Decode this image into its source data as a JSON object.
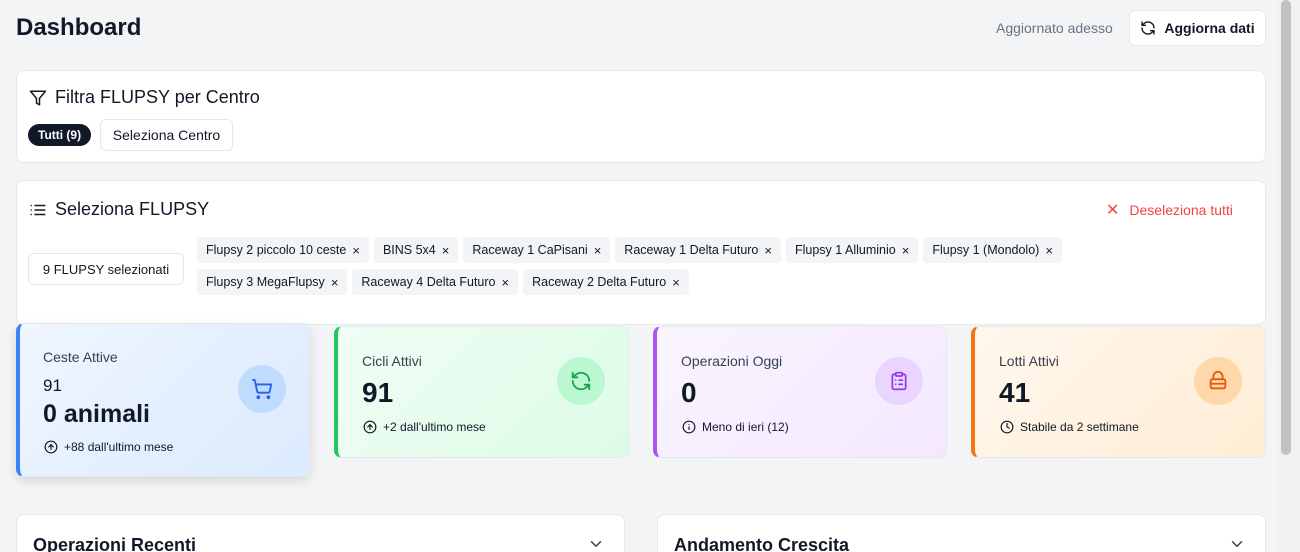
{
  "header": {
    "title": "Dashboard",
    "updated_text": "Aggiornato adesso",
    "refresh_label": "Aggiorna dati"
  },
  "center_filter": {
    "title": "Filtra FLUPSY per Centro",
    "all_label": "Tutti (9)",
    "select_center_label": "Seleziona Centro"
  },
  "flupsy_select": {
    "title": "Seleziona FLUPSY",
    "deselect_label": "Deseleziona tutti",
    "selected_count_label": "9 FLUPSY selezionati",
    "tags": [
      "Flupsy 2 piccolo 10 ceste",
      "BINS 5x4",
      "Raceway 1 CaPisani",
      "Raceway 1 Delta Futuro",
      "Flupsy 1 Alluminio",
      "Flupsy 1 (Mondolo)",
      "Flupsy 3 MegaFlupsy",
      "Raceway 4 Delta Futuro",
      "Raceway 2 Delta Futuro"
    ],
    "remove_symbol": "×"
  },
  "stats": {
    "ceste": {
      "label": "Ceste Attive",
      "count": "91",
      "value": "0 animali",
      "note": "+88 dall'ultimo mese",
      "icon": "cart-icon",
      "accent": "#3b82f6"
    },
    "cicli": {
      "label": "Cicli Attivi",
      "value": "91",
      "note": "+2 dall'ultimo mese",
      "icon": "refresh-icon",
      "accent": "#22c55e"
    },
    "operazioni": {
      "label": "Operazioni Oggi",
      "value": "0",
      "note": "Meno di ieri (12)",
      "icon": "clipboard-icon",
      "accent": "#a855f7"
    },
    "lotti": {
      "label": "Lotti Attivi",
      "value": "41",
      "note": "Stabile da 2 settimane",
      "icon": "layers-icon",
      "accent": "#f97316"
    }
  },
  "sections": {
    "recent_ops": "Operazioni Recenti",
    "growth": "Andamento Crescita"
  }
}
